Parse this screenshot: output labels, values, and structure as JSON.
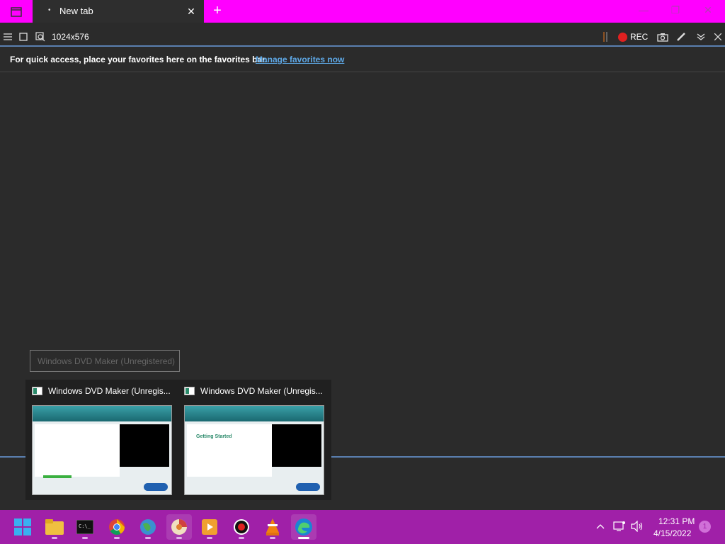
{
  "browser": {
    "tab": {
      "title": "New tab",
      "close_glyph": "✕",
      "favicon_glyph": "•"
    },
    "new_tab_glyph": "+",
    "window_controls": {
      "minimize": "—",
      "restore": "❐",
      "close": "✕"
    }
  },
  "toolbar": {
    "size_readout": "1024x576",
    "rec_label": "REC"
  },
  "favorites_bar": {
    "message": "For quick access, place your favorites here on the favorites bar.",
    "link": "Manage favorites now"
  },
  "tooltip": {
    "text": "Windows DVD Maker (Unregistered)"
  },
  "thumbnails": [
    {
      "title": "Windows DVD Maker (Unregis..."
    },
    {
      "title": "Windows DVD Maker (Unregis...",
      "heading": "Getting Started"
    }
  ],
  "taskbar": {
    "apps": [
      {
        "name": "start"
      },
      {
        "name": "file-explorer"
      },
      {
        "name": "terminal"
      },
      {
        "name": "chrome"
      },
      {
        "name": "globe-app"
      },
      {
        "name": "dvd-maker"
      },
      {
        "name": "video-app"
      },
      {
        "name": "record-app"
      },
      {
        "name": "vlc"
      },
      {
        "name": "edge"
      }
    ],
    "clock": {
      "time": "12:31 PM",
      "date": "4/15/2022"
    },
    "notification_count": "1"
  },
  "colors": {
    "titlebar": "#ff00ff",
    "taskbar": "#a020a8",
    "link": "#5ea8e6",
    "rec": "#e02020"
  }
}
